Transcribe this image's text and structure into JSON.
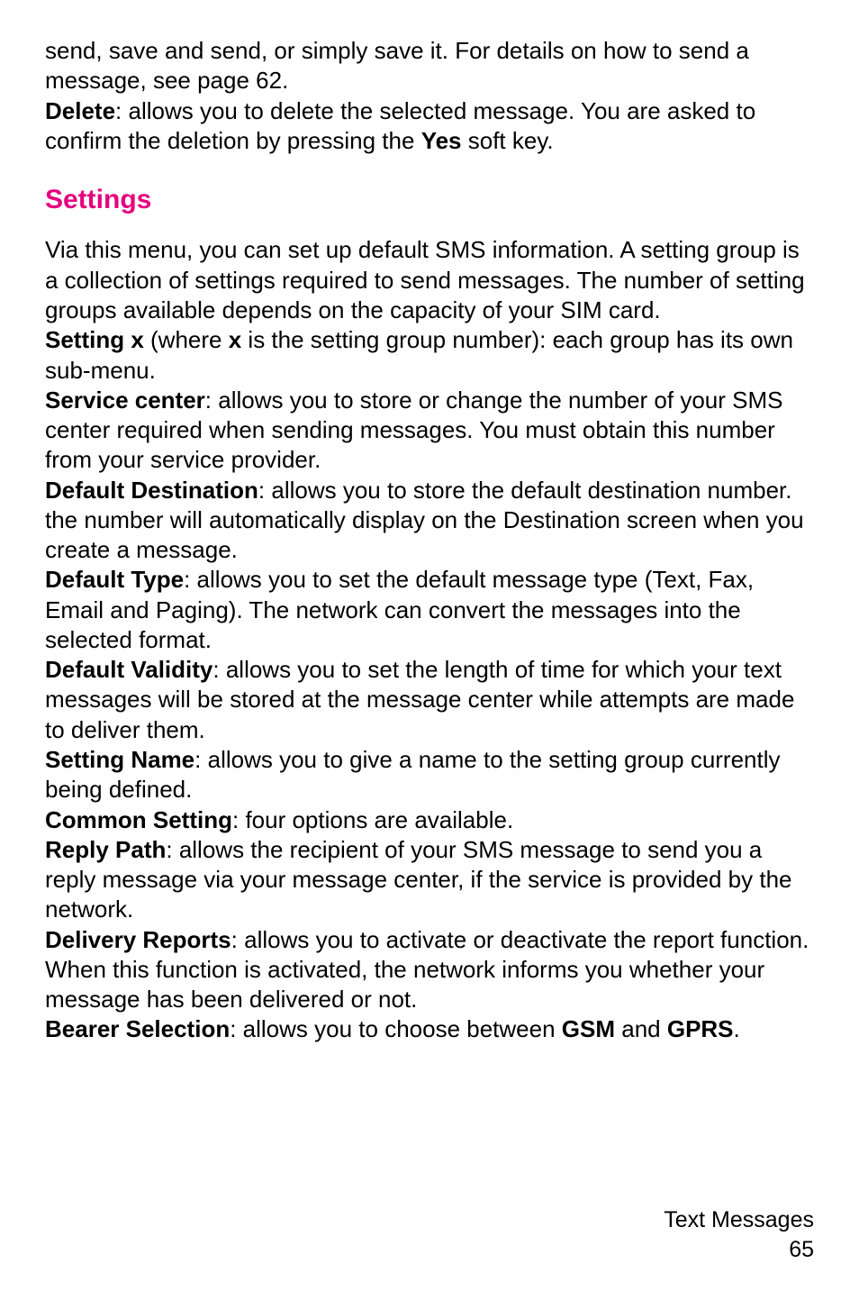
{
  "intro": {
    "p1": "send, save and send, or simply save it. For details on how to send a message, see page 62.",
    "delete_label": "Delete",
    "delete_text_a": ": allows you to delete the selected message. You are asked to confirm the deletion by pressing the ",
    "yes_label": "Yes",
    "delete_text_b": " soft key."
  },
  "settings": {
    "heading": "Settings",
    "p1": "Via this menu, you can set up default SMS information. A setting group is a collection of settings required to send messages. The number of setting groups available depends on the capacity of your SIM card.",
    "setting_x_label": "Setting x",
    "setting_x_text_a": " (where ",
    "setting_x_bold_x": "x",
    "setting_x_text_b": " is the setting group number): each group has its own sub-menu.",
    "service_center_label": "Service center",
    "service_center_text": ": allows you to store or change the number of your SMS center required when sending messages. You must obtain this number from your service provider.",
    "default_destination_label": "Default Destination",
    "default_destination_text": ": allows you to store the default destination number.  the number will automatically display on the Destination screen when you create a message.",
    "default_type_label": "Default Type",
    "default_type_text": ": allows you to set the default message type (Text, Fax, Email and Paging). The network can convert the messages into the selected format.",
    "default_validity_label": "Default Validity",
    "default_validity_text": ": allows you to set the length of time for which your text messages will be stored at the message center while attempts are made to deliver them.",
    "setting_name_label": "Setting Name",
    "setting_name_text": ": allows you to give a name to the setting group currently being defined.",
    "common_setting_label": "Common Setting",
    "common_setting_text": ": four options are available.",
    "reply_path_label": "Reply Path",
    "reply_path_text": ": allows the recipient of your SMS message to send you a reply message via your message center, if the service is provided by the network.",
    "delivery_reports_label": "Delivery Reports",
    "delivery_reports_text": ": allows you to activate or deactivate the report function. When this function is activated, the network informs you whether your message has been delivered or not.",
    "bearer_selection_label": "Bearer Selection",
    "bearer_selection_text_a": ": allows you to choose between ",
    "gsm_label": "GSM",
    "bearer_selection_text_b": " and ",
    "gprs_label": "GPRS",
    "bearer_selection_text_c": "."
  },
  "footer": {
    "section": "Text Messages",
    "page": "65"
  }
}
